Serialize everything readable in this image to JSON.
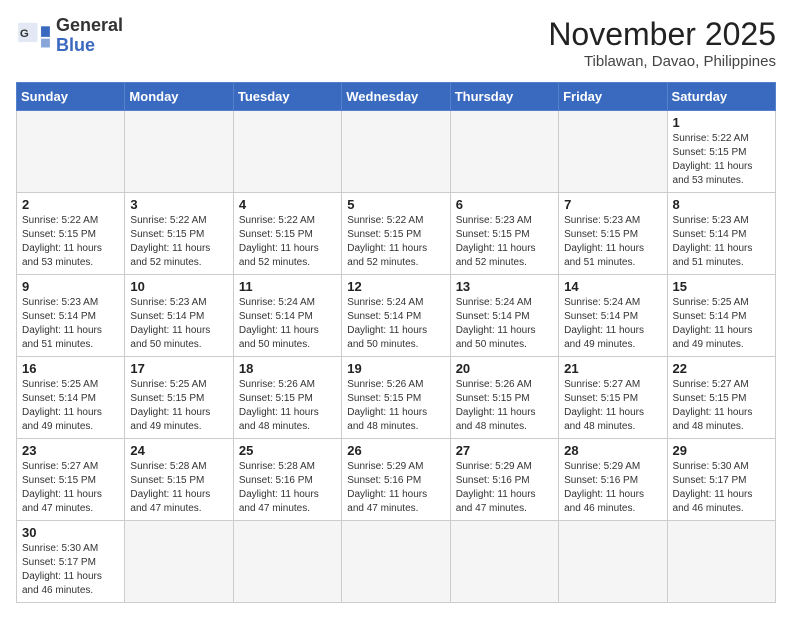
{
  "header": {
    "logo_general": "General",
    "logo_blue": "Blue",
    "month_title": "November 2025",
    "location": "Tiblawan, Davao, Philippines"
  },
  "weekdays": [
    "Sunday",
    "Monday",
    "Tuesday",
    "Wednesday",
    "Thursday",
    "Friday",
    "Saturday"
  ],
  "weeks": [
    [
      {
        "day": "",
        "info": ""
      },
      {
        "day": "",
        "info": ""
      },
      {
        "day": "",
        "info": ""
      },
      {
        "day": "",
        "info": ""
      },
      {
        "day": "",
        "info": ""
      },
      {
        "day": "",
        "info": ""
      },
      {
        "day": "1",
        "info": "Sunrise: 5:22 AM\nSunset: 5:15 PM\nDaylight: 11 hours\nand 53 minutes."
      }
    ],
    [
      {
        "day": "2",
        "info": "Sunrise: 5:22 AM\nSunset: 5:15 PM\nDaylight: 11 hours\nand 53 minutes."
      },
      {
        "day": "3",
        "info": "Sunrise: 5:22 AM\nSunset: 5:15 PM\nDaylight: 11 hours\nand 52 minutes."
      },
      {
        "day": "4",
        "info": "Sunrise: 5:22 AM\nSunset: 5:15 PM\nDaylight: 11 hours\nand 52 minutes."
      },
      {
        "day": "5",
        "info": "Sunrise: 5:22 AM\nSunset: 5:15 PM\nDaylight: 11 hours\nand 52 minutes."
      },
      {
        "day": "6",
        "info": "Sunrise: 5:23 AM\nSunset: 5:15 PM\nDaylight: 11 hours\nand 52 minutes."
      },
      {
        "day": "7",
        "info": "Sunrise: 5:23 AM\nSunset: 5:15 PM\nDaylight: 11 hours\nand 51 minutes."
      },
      {
        "day": "8",
        "info": "Sunrise: 5:23 AM\nSunset: 5:14 PM\nDaylight: 11 hours\nand 51 minutes."
      }
    ],
    [
      {
        "day": "9",
        "info": "Sunrise: 5:23 AM\nSunset: 5:14 PM\nDaylight: 11 hours\nand 51 minutes."
      },
      {
        "day": "10",
        "info": "Sunrise: 5:23 AM\nSunset: 5:14 PM\nDaylight: 11 hours\nand 50 minutes."
      },
      {
        "day": "11",
        "info": "Sunrise: 5:24 AM\nSunset: 5:14 PM\nDaylight: 11 hours\nand 50 minutes."
      },
      {
        "day": "12",
        "info": "Sunrise: 5:24 AM\nSunset: 5:14 PM\nDaylight: 11 hours\nand 50 minutes."
      },
      {
        "day": "13",
        "info": "Sunrise: 5:24 AM\nSunset: 5:14 PM\nDaylight: 11 hours\nand 50 minutes."
      },
      {
        "day": "14",
        "info": "Sunrise: 5:24 AM\nSunset: 5:14 PM\nDaylight: 11 hours\nand 49 minutes."
      },
      {
        "day": "15",
        "info": "Sunrise: 5:25 AM\nSunset: 5:14 PM\nDaylight: 11 hours\nand 49 minutes."
      }
    ],
    [
      {
        "day": "16",
        "info": "Sunrise: 5:25 AM\nSunset: 5:14 PM\nDaylight: 11 hours\nand 49 minutes."
      },
      {
        "day": "17",
        "info": "Sunrise: 5:25 AM\nSunset: 5:15 PM\nDaylight: 11 hours\nand 49 minutes."
      },
      {
        "day": "18",
        "info": "Sunrise: 5:26 AM\nSunset: 5:15 PM\nDaylight: 11 hours\nand 48 minutes."
      },
      {
        "day": "19",
        "info": "Sunrise: 5:26 AM\nSunset: 5:15 PM\nDaylight: 11 hours\nand 48 minutes."
      },
      {
        "day": "20",
        "info": "Sunrise: 5:26 AM\nSunset: 5:15 PM\nDaylight: 11 hours\nand 48 minutes."
      },
      {
        "day": "21",
        "info": "Sunrise: 5:27 AM\nSunset: 5:15 PM\nDaylight: 11 hours\nand 48 minutes."
      },
      {
        "day": "22",
        "info": "Sunrise: 5:27 AM\nSunset: 5:15 PM\nDaylight: 11 hours\nand 48 minutes."
      }
    ],
    [
      {
        "day": "23",
        "info": "Sunrise: 5:27 AM\nSunset: 5:15 PM\nDaylight: 11 hours\nand 47 minutes."
      },
      {
        "day": "24",
        "info": "Sunrise: 5:28 AM\nSunset: 5:15 PM\nDaylight: 11 hours\nand 47 minutes."
      },
      {
        "day": "25",
        "info": "Sunrise: 5:28 AM\nSunset: 5:16 PM\nDaylight: 11 hours\nand 47 minutes."
      },
      {
        "day": "26",
        "info": "Sunrise: 5:29 AM\nSunset: 5:16 PM\nDaylight: 11 hours\nand 47 minutes."
      },
      {
        "day": "27",
        "info": "Sunrise: 5:29 AM\nSunset: 5:16 PM\nDaylight: 11 hours\nand 47 minutes."
      },
      {
        "day": "28",
        "info": "Sunrise: 5:29 AM\nSunset: 5:16 PM\nDaylight: 11 hours\nand 46 minutes."
      },
      {
        "day": "29",
        "info": "Sunrise: 5:30 AM\nSunset: 5:17 PM\nDaylight: 11 hours\nand 46 minutes."
      }
    ],
    [
      {
        "day": "30",
        "info": "Sunrise: 5:30 AM\nSunset: 5:17 PM\nDaylight: 11 hours\nand 46 minutes."
      },
      {
        "day": "",
        "info": ""
      },
      {
        "day": "",
        "info": ""
      },
      {
        "day": "",
        "info": ""
      },
      {
        "day": "",
        "info": ""
      },
      {
        "day": "",
        "info": ""
      },
      {
        "day": "",
        "info": ""
      }
    ]
  ]
}
